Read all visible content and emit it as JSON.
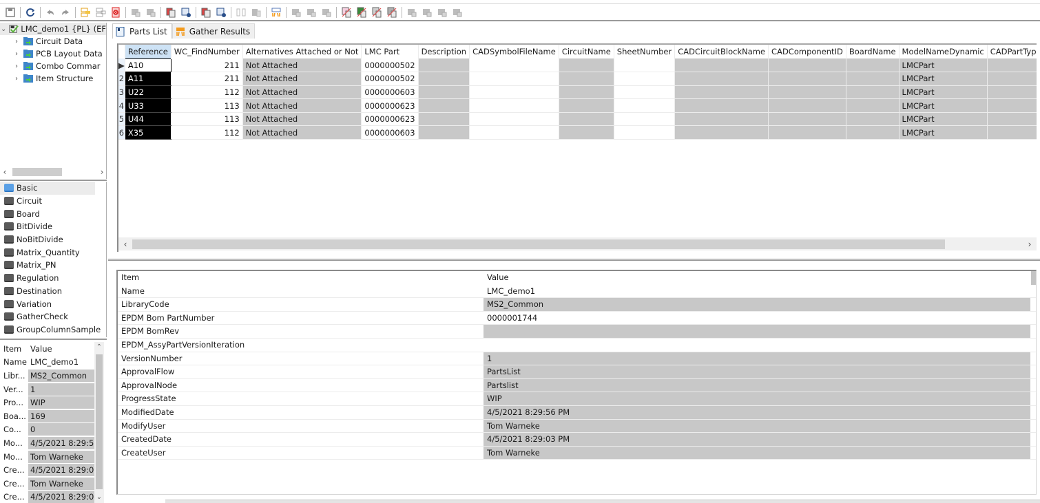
{
  "toolbar": {
    "buttons": [
      {
        "name": "save-icon",
        "group": 1
      },
      {
        "name": "refresh-icon",
        "group": 2
      },
      {
        "name": "undo-icon",
        "group": 3
      },
      {
        "name": "redo-icon",
        "group": 3
      },
      {
        "name": "expand-rows-icon",
        "group": 4
      },
      {
        "name": "collapse-rows-icon",
        "group": 4
      },
      {
        "name": "delete-icon",
        "group": 4
      },
      {
        "name": "insert-row-above-icon",
        "group": 5
      },
      {
        "name": "insert-row-below-icon",
        "group": 5
      },
      {
        "name": "copy-part-icon",
        "group": 6
      },
      {
        "name": "paste-part-icon",
        "group": 6
      },
      {
        "name": "copy-row-icon",
        "group": 7
      },
      {
        "name": "move-row-icon",
        "group": 7
      },
      {
        "name": "merge-icon",
        "group": 8
      },
      {
        "name": "split-icon",
        "group": 8
      },
      {
        "name": "gather-icon",
        "group": 9
      },
      {
        "name": "chip-icon",
        "group": 10
      },
      {
        "name": "export-icon",
        "group": 10
      },
      {
        "name": "import-icon",
        "group": 10
      },
      {
        "name": "cross-link-symbol-icon",
        "group": 11
      },
      {
        "name": "cross-link-layout-icon",
        "group": 11
      },
      {
        "name": "cross-link-icon",
        "group": 11
      },
      {
        "name": "cross-link-grid-icon",
        "group": 11
      },
      {
        "name": "attach-icon",
        "group": 12
      },
      {
        "name": "detach-icon",
        "group": 12
      },
      {
        "name": "attach-group-icon",
        "group": 12
      },
      {
        "name": "detach-group-icon",
        "group": 12
      }
    ]
  },
  "tree": {
    "root": {
      "label": "LMC_demo1 {PL} (EF"
    },
    "children": [
      {
        "label": "Circuit Data"
      },
      {
        "label": "PCB Layout Data"
      },
      {
        "label": "Combo Commar"
      },
      {
        "label": "Item Structure"
      }
    ]
  },
  "views": {
    "active": "Basic",
    "items": [
      "Basic",
      "Circuit",
      "Board",
      "BitDivide",
      "NoBitDivide",
      "Matrix_Quantity",
      "Matrix_PN",
      "Regulation",
      "Destination",
      "Variation",
      "GatherCheck",
      "GroupColumnSample"
    ]
  },
  "left_props": {
    "header": {
      "item": "Item",
      "value": "Value"
    },
    "rows": [
      {
        "k": "Name",
        "v": "LMC_demo1",
        "grey": false
      },
      {
        "k": "Libr...",
        "v": "MS2_Common",
        "grey": true
      },
      {
        "k": "Ver...",
        "v": "1",
        "grey": true
      },
      {
        "k": "Pro...",
        "v": "WIP",
        "grey": true
      },
      {
        "k": "Boa...",
        "v": "169",
        "grey": true
      },
      {
        "k": "Co...",
        "v": "0",
        "grey": true
      },
      {
        "k": "Mo...",
        "v": "4/5/2021 8:29:5",
        "grey": true
      },
      {
        "k": "Mo...",
        "v": "Tom Warneke",
        "grey": true
      },
      {
        "k": "Cre...",
        "v": "4/5/2021 8:29:0",
        "grey": true
      },
      {
        "k": "Cre...",
        "v": "Tom Warneke",
        "grey": true
      },
      {
        "k": "Cre...",
        "v": "4/5/2021 8:29:0",
        "grey": true
      }
    ]
  },
  "tabs": [
    {
      "label": "Parts List",
      "active": true
    },
    {
      "label": "Gather Results",
      "active": false
    }
  ],
  "grid": {
    "columns": [
      "Reference",
      "WC_FindNumber",
      "Alternatives Attached or Not",
      "LMC Part",
      "Description",
      "CADSymbolFileName",
      "CircuitName",
      "SheetNumber",
      "CADCircuitBlockName",
      "CADComponentID",
      "BoardName",
      "ModelNameDynamic",
      "CADPartType"
    ],
    "rows": [
      {
        "rh": "▶",
        "ref": "A10",
        "find": "211",
        "alt": "Not Attached",
        "part": "0000000502",
        "model": "LMCPart"
      },
      {
        "rh": "2",
        "ref": "A11",
        "find": "211",
        "alt": "Not Attached",
        "part": "0000000502",
        "model": "LMCPart"
      },
      {
        "rh": "3",
        "ref": "U22",
        "find": "112",
        "alt": "Not Attached",
        "part": "0000000603",
        "model": "LMCPart"
      },
      {
        "rh": "4",
        "ref": "U33",
        "find": "113",
        "alt": "Not Attached",
        "part": "0000000623",
        "model": "LMCPart"
      },
      {
        "rh": "5",
        "ref": "U44",
        "find": "113",
        "alt": "Not Attached",
        "part": "0000000623",
        "model": "LMCPart"
      },
      {
        "rh": "6",
        "ref": "X35",
        "find": "112",
        "alt": "Not Attached",
        "part": "0000000603",
        "model": "LMCPart"
      }
    ]
  },
  "properties": {
    "header": {
      "item": "Item",
      "value": "Value"
    },
    "rows": [
      {
        "k": "Name",
        "v": "LMC_demo1",
        "grey": false
      },
      {
        "k": "LibraryCode",
        "v": "MS2_Common",
        "grey": true
      },
      {
        "k": "EPDM Bom PartNumber",
        "v": "0000001744",
        "grey": false
      },
      {
        "k": "EPDM BomRev",
        "v": "",
        "grey": true
      },
      {
        "k": "EPDM_AssyPartVersionIteration",
        "v": "",
        "grey": false
      },
      {
        "k": "VersionNumber",
        "v": "1",
        "grey": true
      },
      {
        "k": "ApprovalFlow",
        "v": "PartsList",
        "grey": true
      },
      {
        "k": "ApprovalNode",
        "v": "Partslist",
        "grey": true
      },
      {
        "k": "ProgressState",
        "v": "WIP",
        "grey": true
      },
      {
        "k": "ModifiedDate",
        "v": "4/5/2021 8:29:56 PM",
        "grey": true
      },
      {
        "k": "ModifyUser",
        "v": "Tom Warneke",
        "grey": true
      },
      {
        "k": "CreatedDate",
        "v": "4/5/2021 8:29:03 PM",
        "grey": true
      },
      {
        "k": "CreateUser",
        "v": "Tom Warneke",
        "grey": true
      }
    ]
  }
}
